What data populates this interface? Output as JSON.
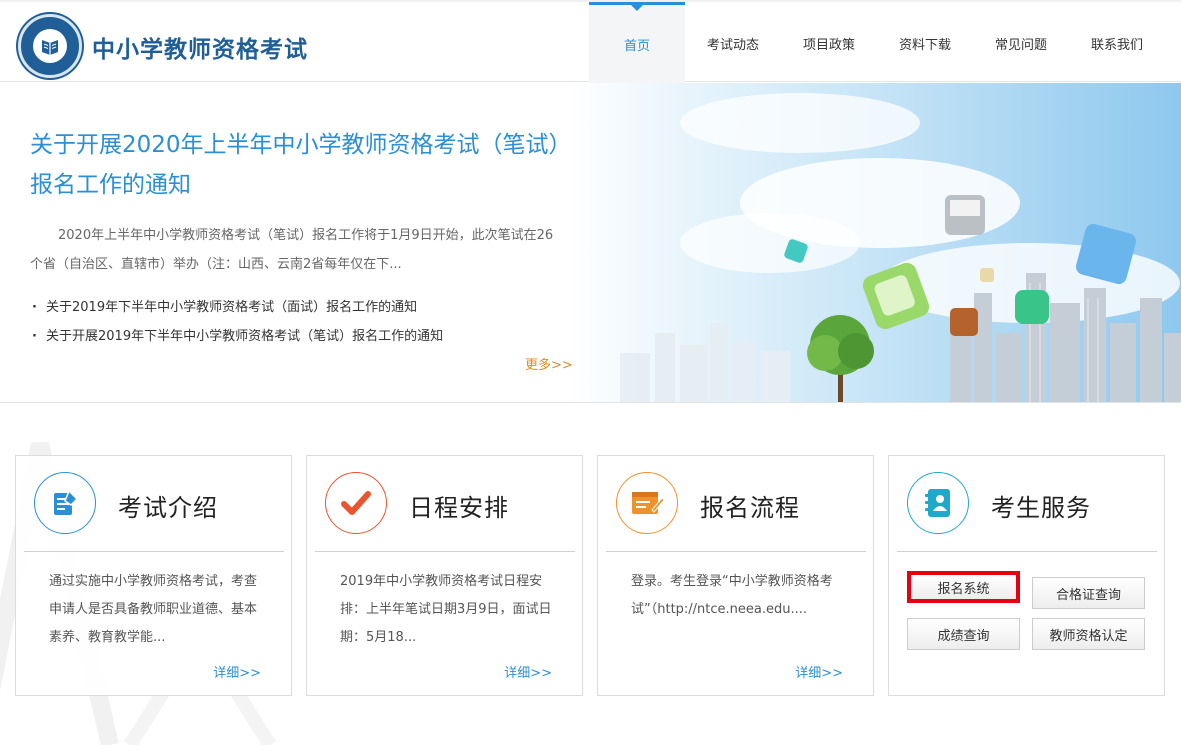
{
  "header": {
    "site_title": "中小学教师资格考试",
    "nav": [
      {
        "label": "首页",
        "active": true
      },
      {
        "label": "考试动态"
      },
      {
        "label": "项目政策"
      },
      {
        "label": "资料下载"
      },
      {
        "label": "常见问题"
      },
      {
        "label": "联系我们"
      }
    ]
  },
  "banner": {
    "title": "关于开展2020年上半年中小学教师资格考试（笔试）报名工作的通知",
    "summary": "2020年上半年中小学教师资格考试（笔试）报名工作将于1月9日开始，此次笔试在26个省（自治区、直辖市）举办（注：山西、云南2省每年仅在下...",
    "news": [
      "关于2019年下半年中小学教师资格考试（面试）报名工作的通知",
      "关于开展2019年下半年中小学教师资格考试（笔试）报名工作的通知"
    ],
    "more": "更多>>"
  },
  "cards": [
    {
      "title": "考试介绍",
      "icon": "document-pen-icon",
      "color": "#2a8fd6",
      "body": "通过实施中小学教师资格考试，考查申请人是否具备教师职业道德、基本素养、教育教学能...",
      "more": "详细>>"
    },
    {
      "title": "日程安排",
      "icon": "checkmark-icon",
      "color": "#e9552e",
      "body": "2019年中小学教师资格考试日程安排：上半年笔试日期3月9日，面试日期：5月18...",
      "more": "详细>>"
    },
    {
      "title": "报名流程",
      "icon": "form-pen-icon",
      "color": "#f0922b",
      "body": "登录。考生登录“中小学教师资格考试”（http://ntce.neea.edu....",
      "more": "详细>>"
    },
    {
      "title": "考生服务",
      "icon": "address-book-icon",
      "color": "#1fa8c9",
      "buttons": [
        "报名系统",
        "合格证查询",
        "成绩查询",
        "教师资格认定"
      ]
    }
  ],
  "colors": {
    "brand": "#1f5e96",
    "accent": "#2a8fd6",
    "more_orange": "#e8871e",
    "highlight_red": "#e60012"
  }
}
